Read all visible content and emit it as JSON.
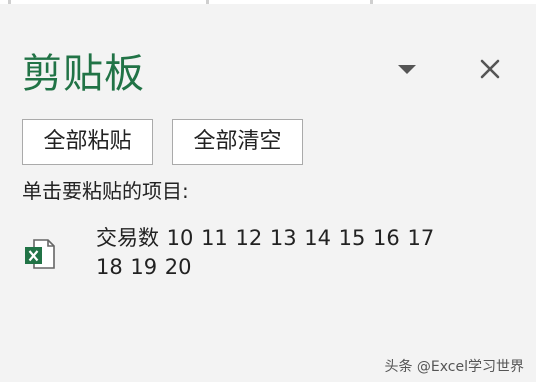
{
  "pane": {
    "title": "剪贴板"
  },
  "toolbar": {
    "paste_all_label": "全部粘贴",
    "clear_all_label": "全部清空"
  },
  "hint_text": "单击要粘贴的项目:",
  "clipboard_items": [
    {
      "icon": "excel-icon",
      "text": "交易数 10 11 12 13 14 15 16 17 18 19 20"
    }
  ],
  "watermark": "头条 @Excel学习世界",
  "colors": {
    "accent": "#217346",
    "background": "#f3f3f3",
    "button_border": "#aaaaaa"
  }
}
